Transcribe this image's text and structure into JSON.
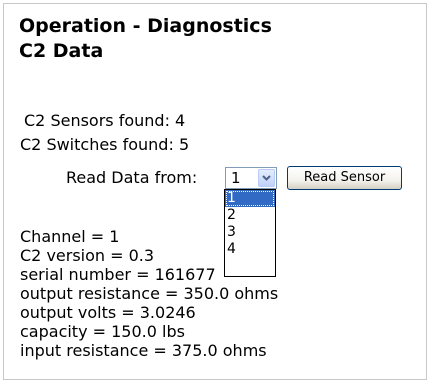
{
  "title": {
    "line1": "Operation - Diagnostics",
    "line2": "C2 Data"
  },
  "summary": {
    "sensors_found": "C2 Sensors found: 4",
    "switches_found": "C2 Switches found: 5"
  },
  "read_controls": {
    "label": "Read Data from:",
    "selected_value": "1",
    "options": [
      "1",
      "2",
      "3",
      "4"
    ],
    "button_label": "Read Sensor"
  },
  "readings": [
    "Channel = 1",
    "C2 version = 0.3",
    "serial number = 161677",
    "output resistance = 350.0 ohms",
    "output volts = 3.0246",
    "capacity = 150.0 lbs",
    "input resistance = 375.0 ohms"
  ],
  "colors": {
    "selection_highlight": "#316ac5",
    "button_border": "#003c74",
    "select_border": "#7f9db9"
  },
  "icons": {
    "select_arrow": "chevron-down-icon"
  }
}
